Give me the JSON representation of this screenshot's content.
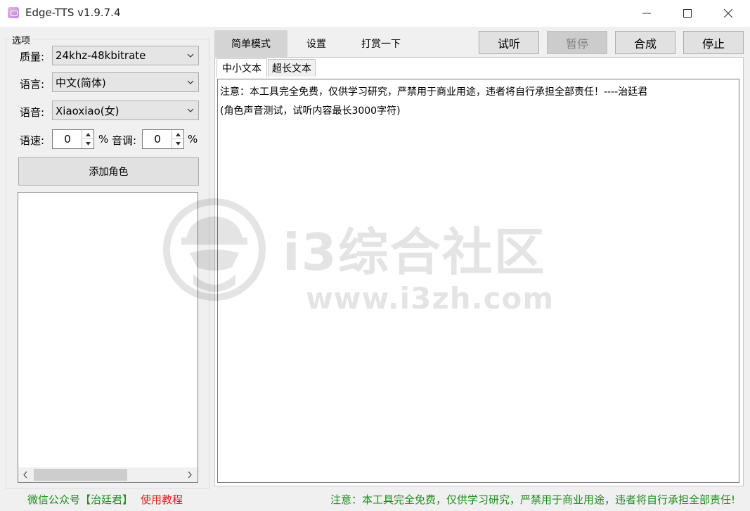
{
  "window": {
    "title": "Edge-TTS v1.9.7.4",
    "controls": [
      "minimize",
      "maximize",
      "close"
    ]
  },
  "options": {
    "legend": "选项",
    "quality": {
      "label": "质量:",
      "value": "24khz-48kbitrate"
    },
    "language": {
      "label": "语言:",
      "value": "中文(简体)"
    },
    "voice": {
      "label": "语音:",
      "value": "Xiaoxiao(女)"
    },
    "rate": {
      "label": "语速:",
      "value": "0",
      "unit": "%"
    },
    "pitch": {
      "label": "音调:",
      "value": "0",
      "unit": "%"
    },
    "add_role_label": "添加角色"
  },
  "top_tabs": [
    {
      "label": "简单模式",
      "active": true
    },
    {
      "label": "设置",
      "active": false
    },
    {
      "label": "打赏一下",
      "active": false
    }
  ],
  "actions": {
    "preview": "试听",
    "pause": "暂停",
    "synthesize": "合成",
    "stop": "停止"
  },
  "sub_tabs": [
    {
      "label": "中小文本",
      "active": true
    },
    {
      "label": "超长文本",
      "active": false
    }
  ],
  "editor": {
    "lines": [
      "注意：本工具完全免费，仅供学习研究，严禁用于商业用途，违者将自行承担全部责任！----治廷君",
      "(角色声音测试，试听内容最长3000字符)"
    ]
  },
  "watermark": {
    "title": "i3综合社区",
    "url": "www.i3zh.com"
  },
  "footer": {
    "wechat": "微信公众号【治廷君】",
    "tutorial": "使用教程",
    "notice": "注意：本工具完全免费，仅供学习研究，严禁用于商业用途，违者将自行承担全部责任!"
  },
  "colors": {
    "footer_green": "#1e8c1e",
    "footer_red": "#d91d1d"
  }
}
